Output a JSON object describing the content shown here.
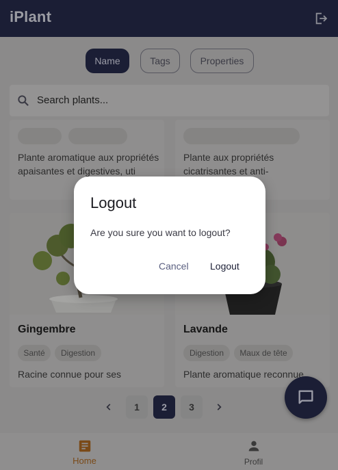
{
  "app": {
    "title": "iPlant"
  },
  "filters": [
    {
      "label": "Name",
      "active": true
    },
    {
      "label": "Tags",
      "active": false
    },
    {
      "label": "Properties",
      "active": false
    }
  ],
  "search": {
    "placeholder": "Search plants..."
  },
  "cards_top": [
    {
      "description": "Plante aromatique aux propriétés apaisantes et digestives, uti"
    },
    {
      "description": "Plante aux propriétés cicatrisantes et anti-"
    }
  ],
  "cards": [
    {
      "name": "Gingembre",
      "tags": [
        "Santé",
        "Digestion"
      ],
      "description": "Racine connue pour ses"
    },
    {
      "name": "Lavande",
      "tags": [
        "Digestion",
        "Maux de tête"
      ],
      "description": "Plante aromatique reconnue"
    }
  ],
  "pagination": {
    "pages": [
      "1",
      "2",
      "3"
    ],
    "current": "2"
  },
  "bottom_nav": [
    {
      "label": "Home",
      "icon": "article-icon",
      "active": true
    },
    {
      "label": "Profil",
      "icon": "person-icon",
      "active": false
    }
  ],
  "dialog": {
    "title": "Logout",
    "message": "Are you sure you want to logout?",
    "cancel_label": "Cancel",
    "confirm_label": "Logout"
  },
  "colors": {
    "primary": "#1b1e35",
    "accent": "#e8790f",
    "scrim_dimmed": "#8b8a8a",
    "dialog_bg": "#ffffff"
  }
}
